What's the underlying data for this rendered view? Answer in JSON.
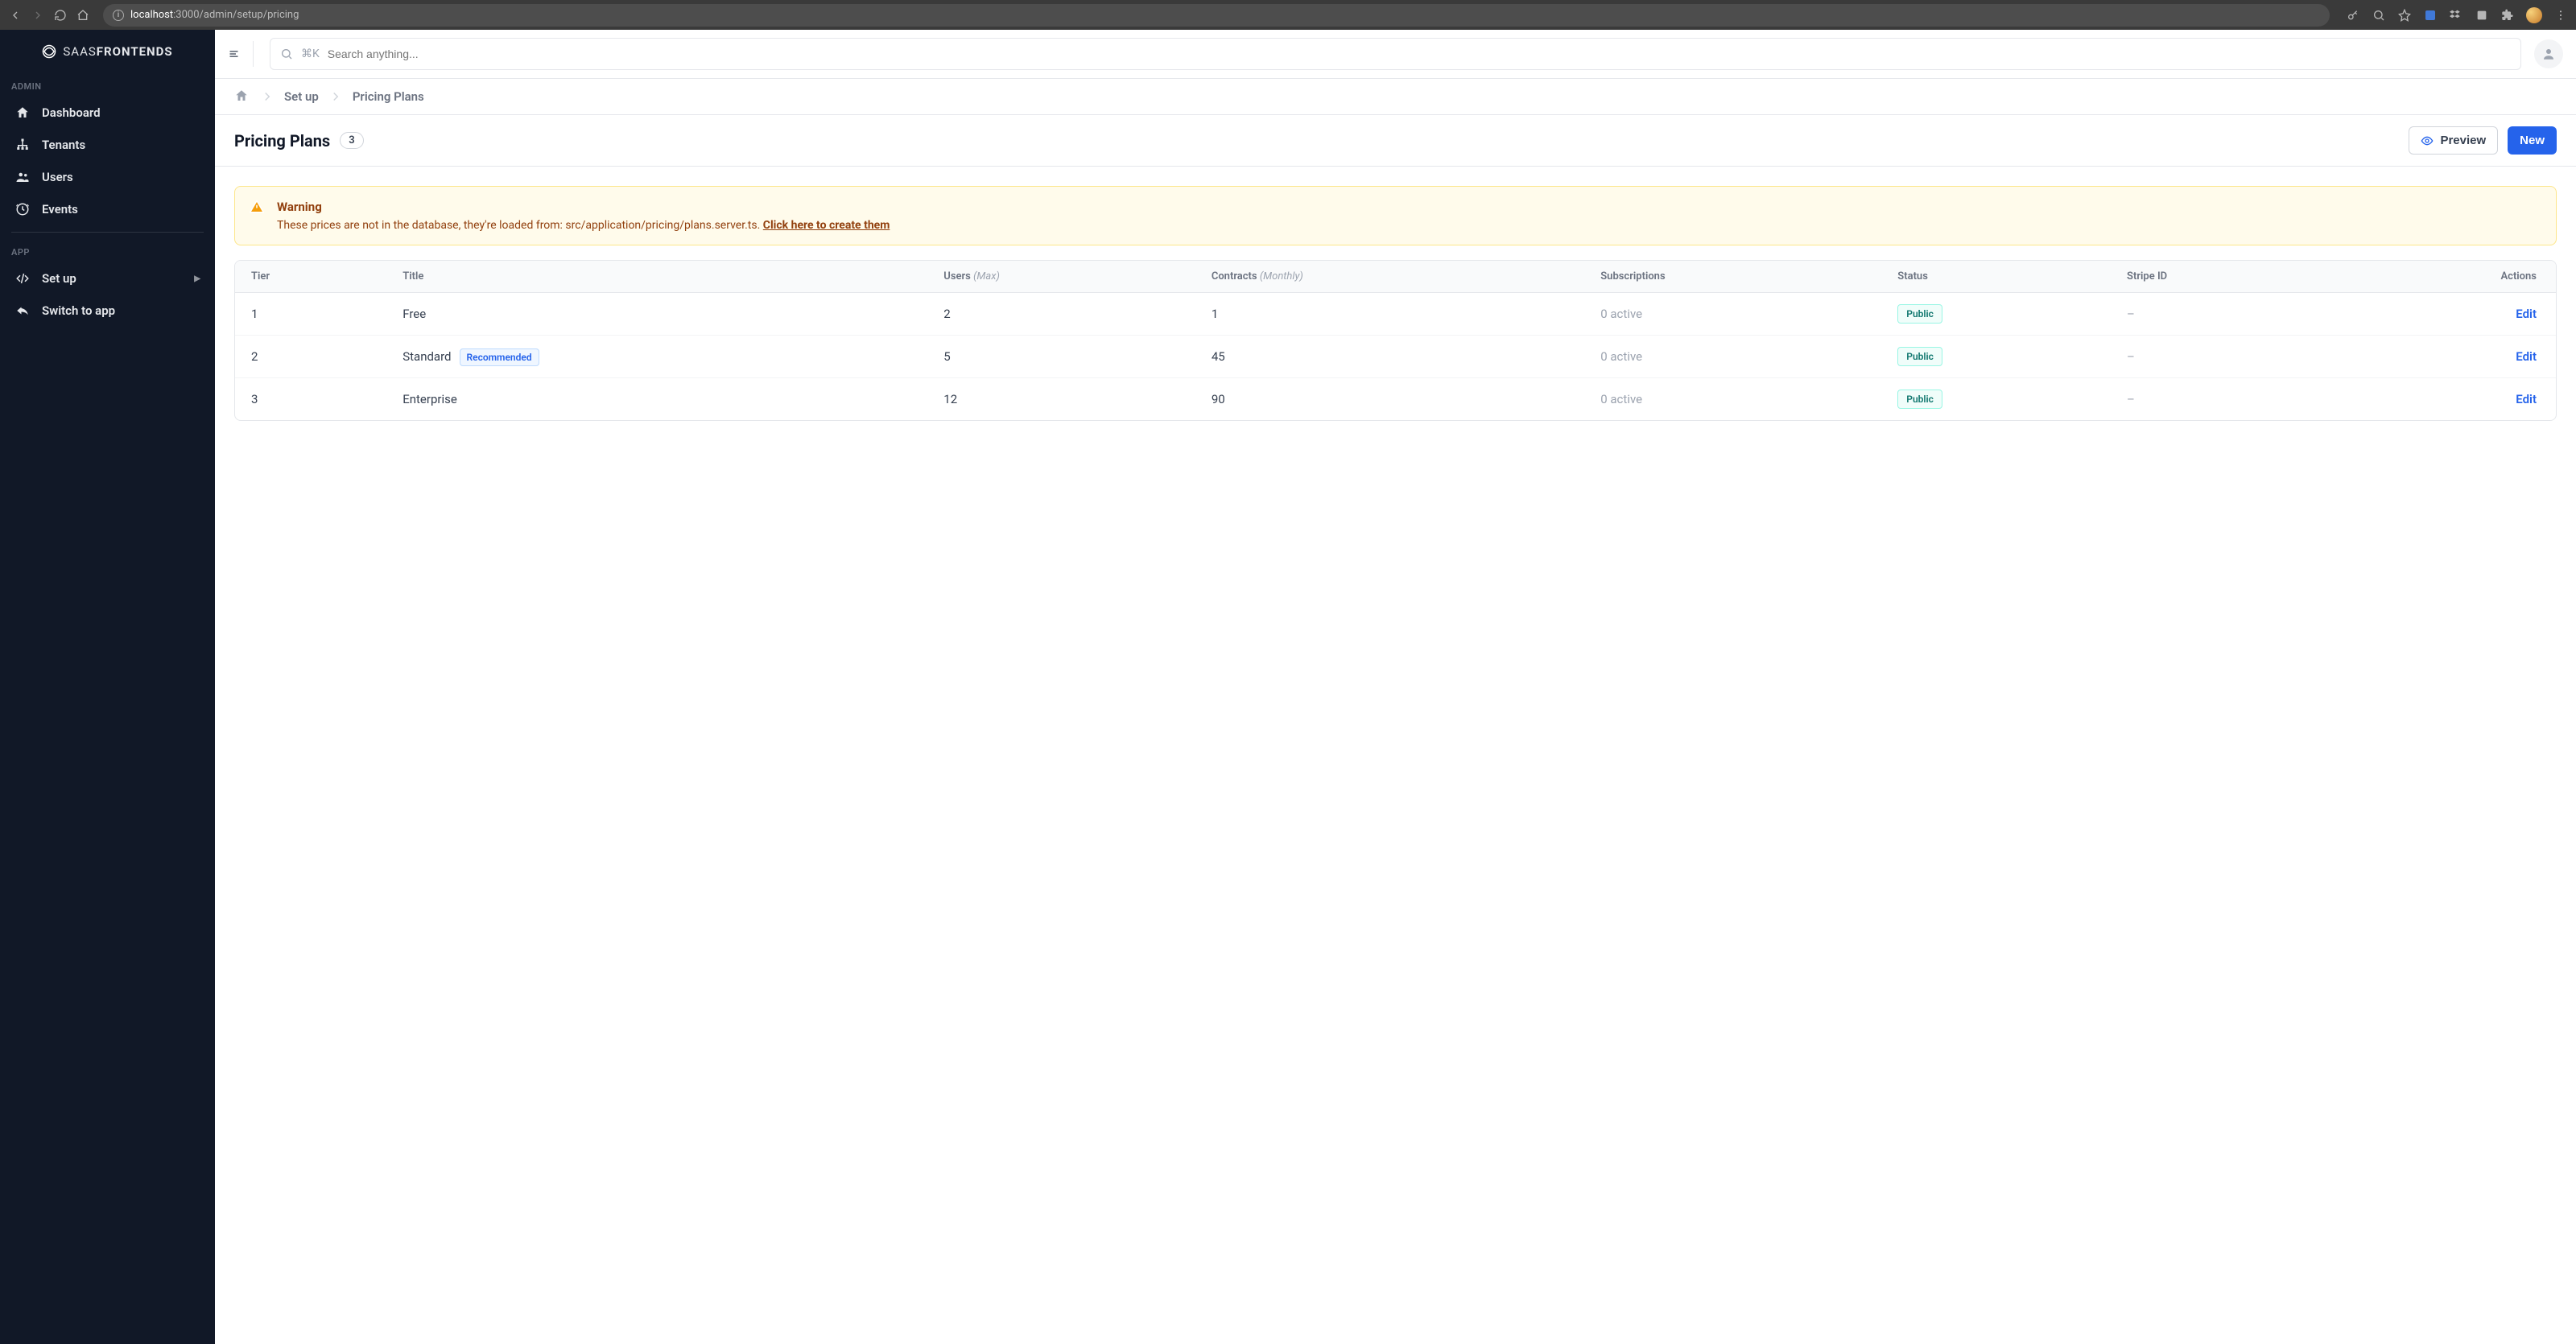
{
  "browser": {
    "url_host": "localhost",
    "url_port_and_path": ":3000/admin/setup/pricing"
  },
  "brand": {
    "light": "SAAS",
    "bold": "FRONTENDS"
  },
  "sidebar": {
    "sections": [
      {
        "label": "ADMIN",
        "items": [
          {
            "icon": "home",
            "label": "Dashboard"
          },
          {
            "icon": "sitemap",
            "label": "Tenants"
          },
          {
            "icon": "users",
            "label": "Users"
          },
          {
            "icon": "clock",
            "label": "Events"
          }
        ]
      },
      {
        "label": "APP",
        "items": [
          {
            "icon": "code",
            "label": "Set up",
            "has_sub": true
          },
          {
            "icon": "reply",
            "label": "Switch to app"
          }
        ]
      }
    ]
  },
  "search": {
    "shortcut": "⌘K",
    "placeholder": "Search anything..."
  },
  "breadcrumb": {
    "setup": "Set up",
    "page": "Pricing Plans"
  },
  "heading": {
    "title": "Pricing Plans",
    "count": "3",
    "preview": "Preview",
    "new": "New"
  },
  "warning": {
    "title": "Warning",
    "text": "These prices are not in the database, they're loaded from: src/application/pricing/plans.server.ts. ",
    "link": "Click here to create them"
  },
  "table": {
    "headers": {
      "tier": "Tier",
      "title": "Title",
      "users": "Users",
      "users_sub": "(Max)",
      "contracts": "Contracts",
      "contracts_sub": "(Monthly)",
      "subscriptions": "Subscriptions",
      "status": "Status",
      "stripe": "Stripe ID",
      "actions": "Actions"
    },
    "recommended_label": "Recommended",
    "edit_label": "Edit",
    "rows": [
      {
        "tier": "1",
        "title": "Free",
        "recommended": false,
        "users": "2",
        "contracts": "1",
        "subscriptions": "0 active",
        "status": "Public",
        "stripe": "–"
      },
      {
        "tier": "2",
        "title": "Standard",
        "recommended": true,
        "users": "5",
        "contracts": "45",
        "subscriptions": "0 active",
        "status": "Public",
        "stripe": "–"
      },
      {
        "tier": "3",
        "title": "Enterprise",
        "recommended": false,
        "users": "12",
        "contracts": "90",
        "subscriptions": "0 active",
        "status": "Public",
        "stripe": "–"
      }
    ]
  }
}
